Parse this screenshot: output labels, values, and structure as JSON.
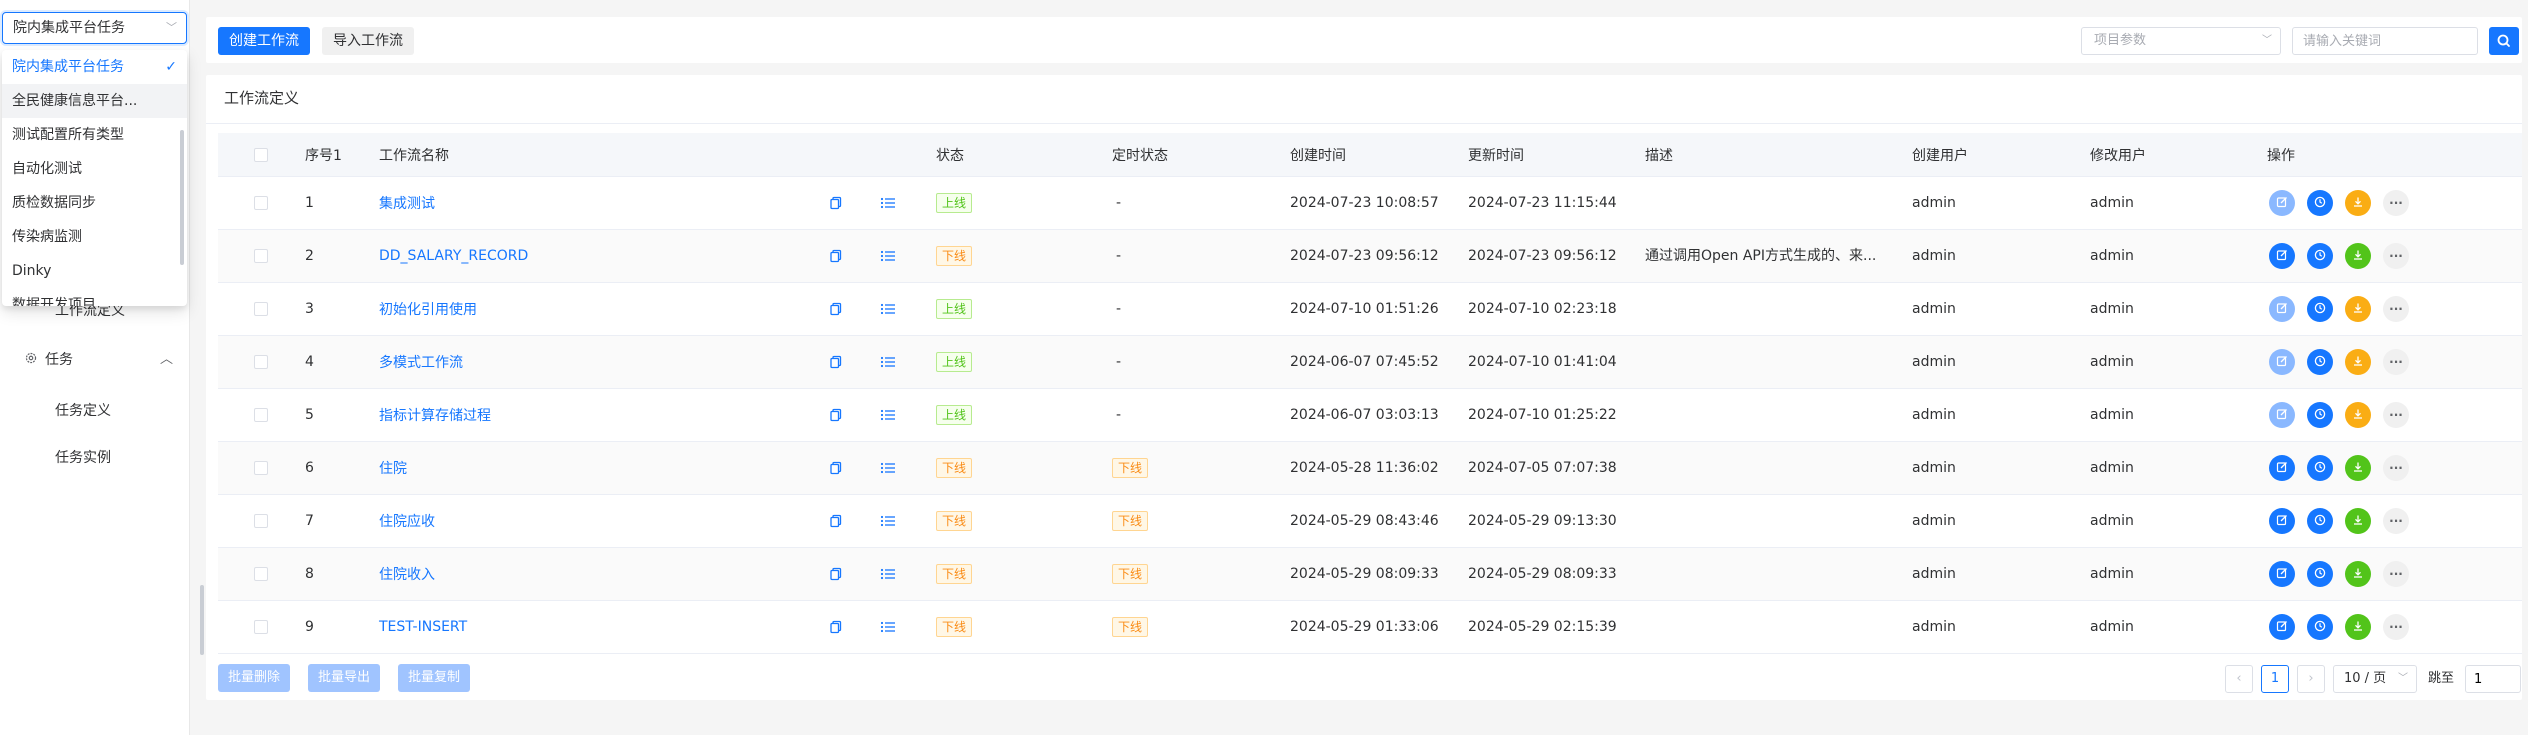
{
  "sidebar": {
    "project_select_value": "院内集成平台任务",
    "project_options": [
      {
        "label": "院内集成平台任务",
        "selected": true
      },
      {
        "label": "全民健康信息平台...",
        "hovered": true
      },
      {
        "label": "测试配置所有类型"
      },
      {
        "label": "自动化测试"
      },
      {
        "label": "质检数据同步"
      },
      {
        "label": "传染病监测"
      },
      {
        "label": "Dinky"
      },
      {
        "label": "数据开发项目"
      }
    ],
    "menu_partial_label": "工作流定义",
    "menu_group_label": "任务",
    "menu_items": [
      "任务定义",
      "任务实例"
    ]
  },
  "toolbar": {
    "create_label": "创建工作流",
    "import_label": "导入工作流",
    "param_placeholder": "项目参数",
    "keyword_placeholder": "请输入关键词"
  },
  "card": {
    "title": "工作流定义"
  },
  "table": {
    "headers": {
      "index": "序号1",
      "name": "工作流名称",
      "status": "状态",
      "schedule_status": "定时状态",
      "created": "创建时间",
      "updated": "更新时间",
      "desc": "描述",
      "creator": "创建用户",
      "modifier": "修改用户",
      "actions": "操作"
    },
    "rows": [
      {
        "index": "1",
        "name": "集成测试",
        "status": "上线",
        "status_type": "on",
        "schedule": "-",
        "created": "2024-07-23 10:08:57",
        "updated": "2024-07-23 11:15:44",
        "desc": "",
        "creator": "admin",
        "modifier": "admin",
        "edit_disabled": true,
        "download_color": "orange"
      },
      {
        "index": "2",
        "name": "DD_SALARY_RECORD",
        "status": "下线",
        "status_type": "off",
        "schedule": "-",
        "created": "2024-07-23 09:56:12",
        "updated": "2024-07-23 09:56:12",
        "desc": "通过调用Open API方式生成的、来...",
        "creator": "admin",
        "modifier": "admin",
        "edit_disabled": false,
        "download_color": "green"
      },
      {
        "index": "3",
        "name": "初始化引用使用",
        "status": "上线",
        "status_type": "on",
        "schedule": "-",
        "created": "2024-07-10 01:51:26",
        "updated": "2024-07-10 02:23:18",
        "desc": "",
        "creator": "admin",
        "modifier": "admin",
        "edit_disabled": true,
        "download_color": "orange"
      },
      {
        "index": "4",
        "name": "多模式工作流",
        "status": "上线",
        "status_type": "on",
        "schedule": "-",
        "created": "2024-06-07 07:45:52",
        "updated": "2024-07-10 01:41:04",
        "desc": "",
        "creator": "admin",
        "modifier": "admin",
        "edit_disabled": true,
        "download_color": "orange"
      },
      {
        "index": "5",
        "name": "指标计算存储过程",
        "status": "上线",
        "status_type": "on",
        "schedule": "-",
        "created": "2024-06-07 03:03:13",
        "updated": "2024-07-10 01:25:22",
        "desc": "",
        "creator": "admin",
        "modifier": "admin",
        "edit_disabled": true,
        "download_color": "orange"
      },
      {
        "index": "6",
        "name": "住院",
        "status": "下线",
        "status_type": "off",
        "schedule": "下线",
        "created": "2024-05-28 11:36:02",
        "updated": "2024-07-05 07:07:38",
        "desc": "",
        "creator": "admin",
        "modifier": "admin",
        "edit_disabled": false,
        "download_color": "green"
      },
      {
        "index": "7",
        "name": "住院应收",
        "status": "下线",
        "status_type": "off",
        "schedule": "下线",
        "created": "2024-05-29 08:43:46",
        "updated": "2024-05-29 09:13:30",
        "desc": "",
        "creator": "admin",
        "modifier": "admin",
        "edit_disabled": false,
        "download_color": "green"
      },
      {
        "index": "8",
        "name": "住院收入",
        "status": "下线",
        "status_type": "off",
        "schedule": "下线",
        "created": "2024-05-29 08:09:33",
        "updated": "2024-05-29 08:09:33",
        "desc": "",
        "creator": "admin",
        "modifier": "admin",
        "edit_disabled": false,
        "download_color": "green"
      },
      {
        "index": "9",
        "name": "TEST-INSERT",
        "status": "下线",
        "status_type": "off",
        "schedule": "下线",
        "created": "2024-05-29 01:33:06",
        "updated": "2024-05-29 02:15:39",
        "desc": "",
        "creator": "admin",
        "modifier": "admin",
        "edit_disabled": false,
        "download_color": "green"
      }
    ]
  },
  "footer": {
    "batch_delete": "批量删除",
    "batch_export": "批量导出",
    "batch_copy": "批量复制",
    "current_page": "1",
    "page_size": "10 / 页",
    "jump_label": "跳至",
    "jump_value": "1"
  },
  "colors": {
    "primary": "#1677ff",
    "online": "#52c41a",
    "offline": "#fa8c16"
  }
}
